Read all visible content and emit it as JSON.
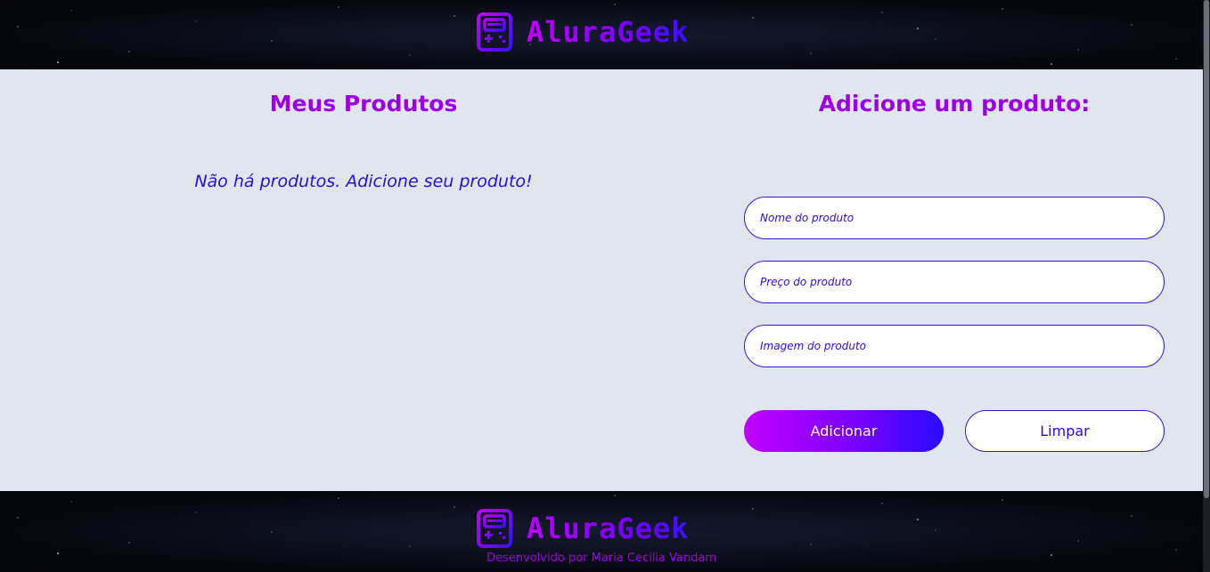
{
  "brand": {
    "name": "AluraGeek",
    "icon": "game-console-icon"
  },
  "products": {
    "title": "Meus Produtos",
    "empty_message": "Não há produtos. Adicione seu produto!"
  },
  "form": {
    "title": "Adicione um produto:",
    "name_placeholder": "Nome do produto",
    "price_placeholder": "Preço do produto",
    "image_placeholder": "Imagem do produto",
    "add_label": "Adicionar",
    "clear_label": "Limpar"
  },
  "footer": {
    "credit": "Desenvolvido por Maria Cecilia Vandam"
  },
  "colors": {
    "accent_purple": "#9b00e8",
    "accent_blue": "#2a0ddc",
    "panel_background": "#e0e6f0"
  }
}
